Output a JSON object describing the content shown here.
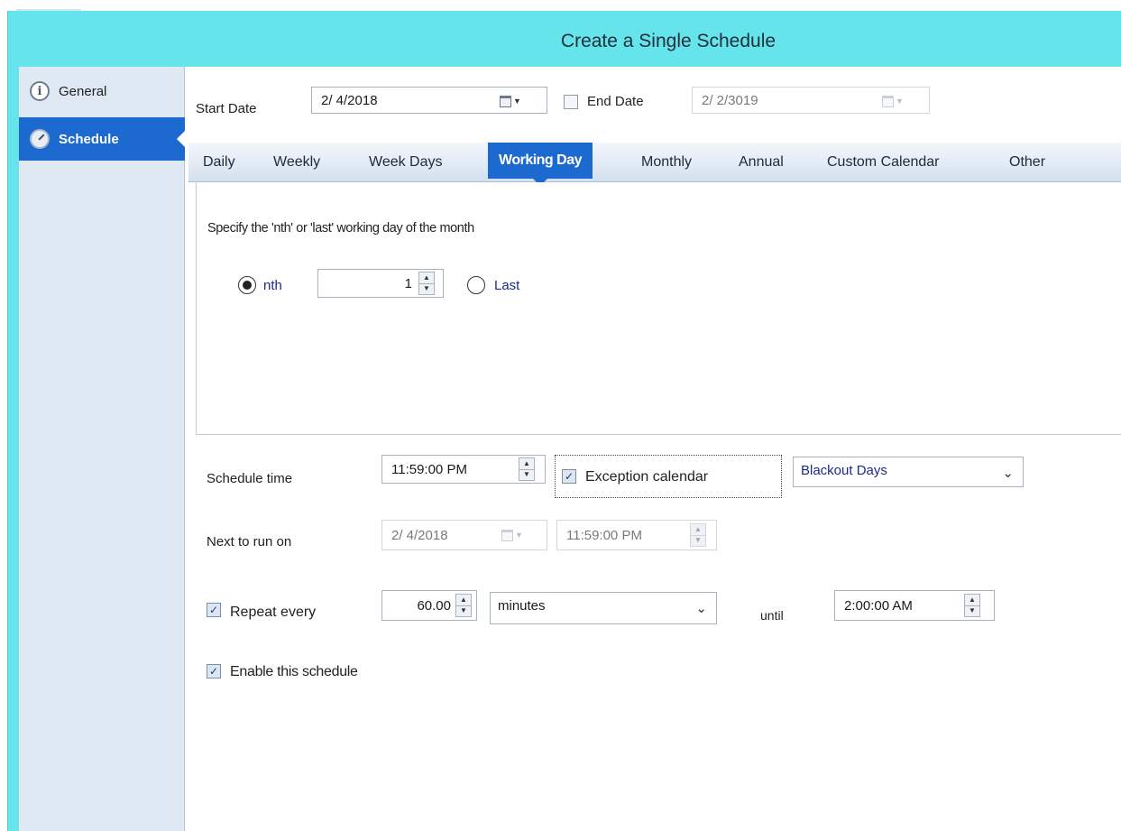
{
  "window": {
    "title": "Create a Single Schedule"
  },
  "sidebar": {
    "items": [
      {
        "label": "General",
        "icon": "info-icon",
        "selected": false
      },
      {
        "label": "Schedule",
        "icon": "clock-icon",
        "selected": true
      }
    ]
  },
  "dates": {
    "start_label": "Start Date",
    "start_value": "2/ 4/2018",
    "end_label": "End Date",
    "end_checked": false,
    "end_value": "2/ 2/3019"
  },
  "tabs": [
    "Daily",
    "Weekly",
    "Week Days",
    "Working Day",
    "Monthly",
    "Annual",
    "Custom Calendar",
    "Other"
  ],
  "active_tab": "Working Day",
  "working_day": {
    "instruction": "Specify the 'nth' or 'last' working day of the month",
    "nth_label": "nth",
    "nth_selected": true,
    "nth_value": "1",
    "last_label": "Last"
  },
  "schedule": {
    "time_label": "Schedule time",
    "time_value": "11:59:00 PM",
    "exception_label": "Exception calendar",
    "exception_checked": true,
    "exception_calendar": "Blackout Days",
    "next_label": "Next to run on",
    "next_date": "2/ 4/2018",
    "next_time": "11:59:00 PM",
    "repeat_label": "Repeat every",
    "repeat_checked": true,
    "repeat_value": "60.00",
    "repeat_unit": "minutes",
    "until_label": "until",
    "until_value": "2:00:00 AM",
    "enable_label": "Enable this schedule",
    "enable_checked": true
  },
  "colors": {
    "window_bg": "#65e4ec",
    "accent": "#1c6ad0",
    "sidebar_bg": "#dfe9f4"
  }
}
